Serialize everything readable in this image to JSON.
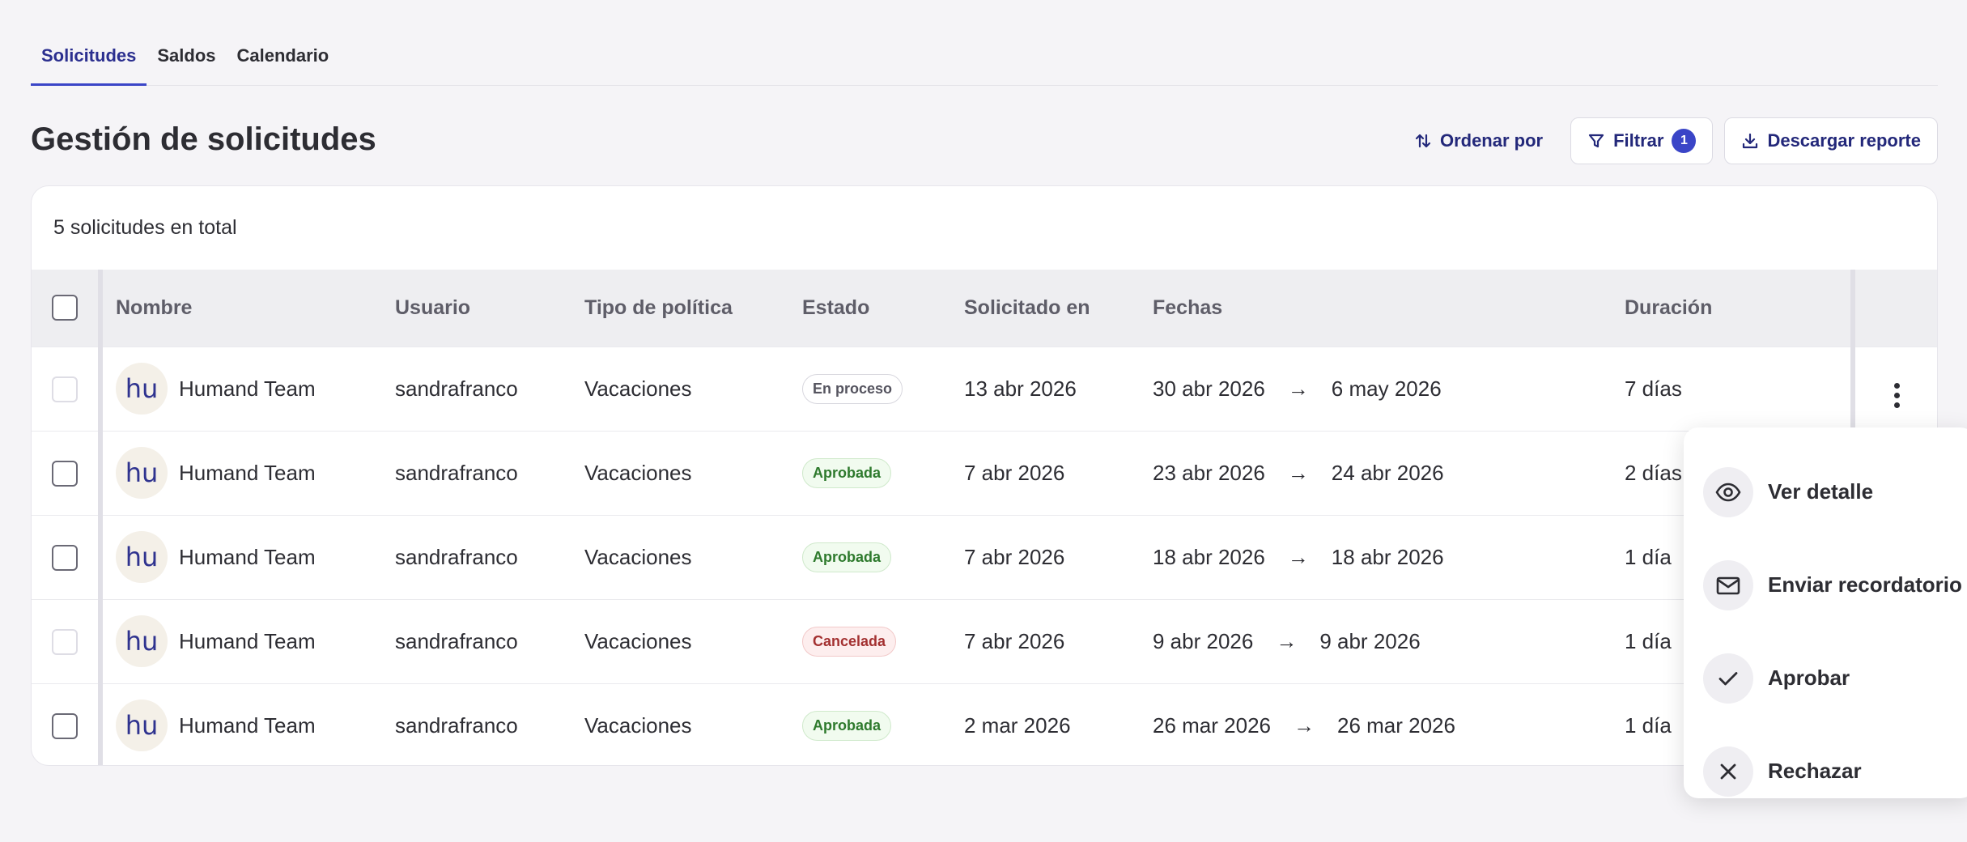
{
  "tabs": [
    {
      "label": "Solicitudes"
    },
    {
      "label": "Saldos"
    },
    {
      "label": "Calendario"
    }
  ],
  "header": {
    "title": "Gestión de solicitudes",
    "sort_label": "Ordenar por",
    "filter_label": "Filtrar",
    "filter_count": "1",
    "download_label": "Descargar reporte"
  },
  "summary": "5 solicitudes en total",
  "columns": {
    "name": "Nombre",
    "user": "Usuario",
    "policy": "Tipo de política",
    "status": "Estado",
    "requested": "Solicitado en",
    "dates": "Fechas",
    "duration": "Duración"
  },
  "rows": [
    {
      "avatar": "hu",
      "name": "Humand Team",
      "user": "sandrafranco",
      "policy": "Vacaciones",
      "status": "En proceso",
      "requested": "13 abr 2026",
      "from": "30 abr 2026",
      "arrow": "→",
      "to": "6 may 2026",
      "duration": "7 días"
    },
    {
      "avatar": "hu",
      "name": "Humand Team",
      "user": "sandrafranco",
      "policy": "Vacaciones",
      "status": "Aprobada",
      "requested": "7 abr 2026",
      "from": "23 abr 2026",
      "arrow": "→",
      "to": "24 abr 2026",
      "duration": "2 días"
    },
    {
      "avatar": "hu",
      "name": "Humand Team",
      "user": "sandrafranco",
      "policy": "Vacaciones",
      "status": "Aprobada",
      "requested": "7 abr 2026",
      "from": "18 abr 2026",
      "arrow": "→",
      "to": "18 abr 2026",
      "duration": "1 día"
    },
    {
      "avatar": "hu",
      "name": "Humand Team",
      "user": "sandrafranco",
      "policy": "Vacaciones",
      "status": "Cancelada",
      "requested": "7 abr 2026",
      "from": "9 abr 2026",
      "arrow": "→",
      "to": "9 abr 2026",
      "duration": "1 día"
    },
    {
      "avatar": "hu",
      "name": "Humand Team",
      "user": "sandrafranco",
      "policy": "Vacaciones",
      "status": "Aprobada",
      "requested": "2 mar 2026",
      "from": "26 mar 2026",
      "arrow": "→",
      "to": "26 mar 2026",
      "duration": "1 día"
    }
  ],
  "menu": [
    {
      "label": "Ver detalle",
      "icon": "eye-icon"
    },
    {
      "label": "Enviar recordatorio",
      "icon": "mail-icon"
    },
    {
      "label": "Aprobar",
      "icon": "check-icon"
    },
    {
      "label": "Rechazar",
      "icon": "close-icon"
    }
  ]
}
